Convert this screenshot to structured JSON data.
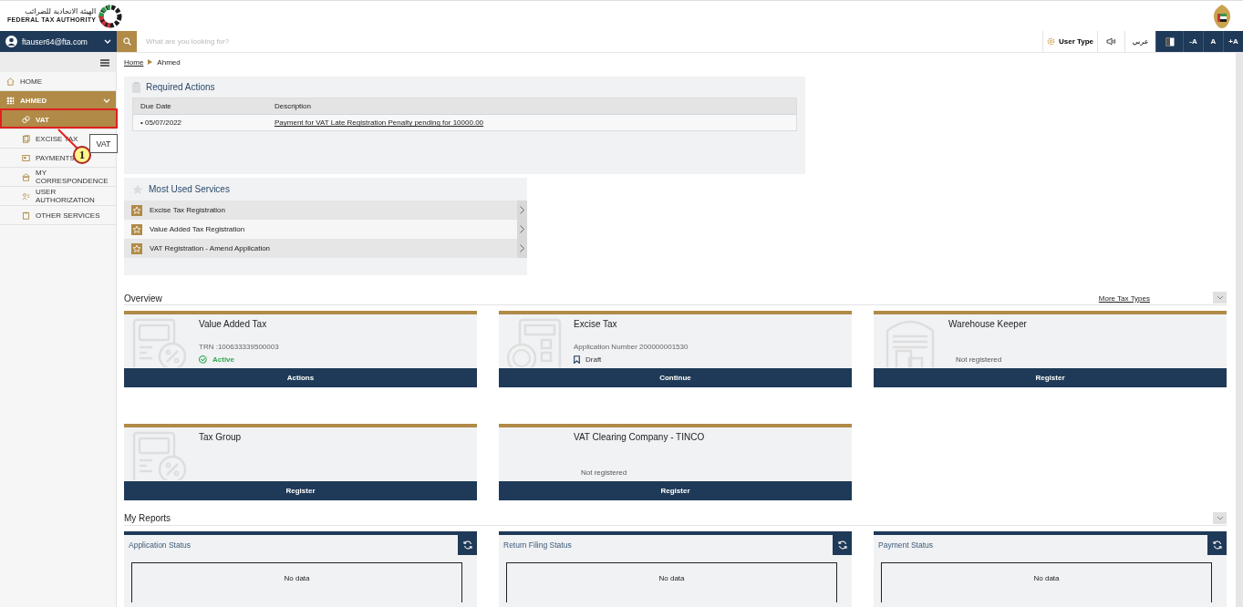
{
  "header": {
    "logo_arabic": "الهيئة الاتحادية للضرائب",
    "logo_english": "FEDERAL TAX AUTHORITY"
  },
  "user": {
    "email": "ftauser64@fta.com"
  },
  "search": {
    "placeholder": "What are you looking for?"
  },
  "toolbar": {
    "user_type": "User Type",
    "language": "عربي",
    "font_buttons": [
      "-A",
      "A",
      "+A"
    ]
  },
  "sidebar": {
    "items": [
      {
        "label": "HOME",
        "selected": false
      },
      {
        "label": "AHMED",
        "selected": false,
        "expanded": true,
        "children": [
          {
            "label": "VAT",
            "selected": true
          },
          {
            "label": "EXCISE TAX",
            "selected": false
          },
          {
            "label": "PAYMENTS",
            "selected": false
          },
          {
            "label": "MY CORRESPONDENCE",
            "selected": false
          },
          {
            "label": "USER AUTHORIZATION",
            "selected": false
          },
          {
            "label": "OTHER SERVICES",
            "selected": false
          }
        ]
      }
    ]
  },
  "annotation": {
    "number": "1",
    "label": "VAT"
  },
  "breadcrumb": [
    {
      "label": "Home",
      "selected": false
    },
    {
      "label": "Ahmed",
      "selected": true
    }
  ],
  "required_actions": {
    "title": "Required Actions",
    "columns": [
      "Due Date",
      "Description"
    ],
    "rows": [
      {
        "due_date": "• 05/07/2022",
        "description": "Payment for VAT Late Registration Penalty pending for 10000.00"
      }
    ]
  },
  "most_used_services": {
    "title": "Most Used Services",
    "items": [
      "Excise Tax Registration",
      "Value Added Tax Registration",
      "VAT Registration - Amend Application"
    ]
  },
  "overview": {
    "title": "Overview",
    "more_link": "More Tax Types",
    "cards": [
      {
        "title": "Value Added Tax",
        "detail": "TRN :100633339500003",
        "status": {
          "kind": "active",
          "label": "Active"
        },
        "button": "Actions"
      },
      {
        "title": "Excise Tax",
        "detail": "Application Number 200000001530",
        "status": {
          "kind": "draft",
          "label": "Draft"
        },
        "button": "Continue"
      },
      {
        "title": "Warehouse Keeper",
        "status": {
          "kind": "plain",
          "label": "Not registered"
        },
        "button": "Register"
      },
      {
        "title": "Tax Group",
        "button": "Register"
      },
      {
        "title": "VAT Clearing Company - TINCO",
        "status": {
          "kind": "plain",
          "label": "Not registered"
        },
        "button": "Register"
      }
    ]
  },
  "reports": {
    "title": "My Reports",
    "cards": [
      {
        "title": "Application Status",
        "message": "No data"
      },
      {
        "title": "Return Filing Status",
        "message": "No data"
      },
      {
        "title": "Payment Status",
        "message": "No data"
      }
    ]
  }
}
